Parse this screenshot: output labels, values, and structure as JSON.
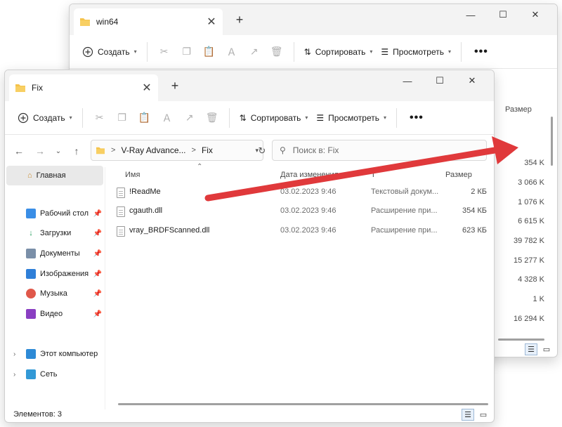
{
  "colors": {
    "folder": "#f5c34b",
    "arrow": "#e0393b",
    "selection": "#e9e9e9",
    "accent": "#2f6fbd"
  },
  "back_window": {
    "tab_title": "win64",
    "toolbar": {
      "create_label": "Создать",
      "sort_label": "Сортировать",
      "view_label": "Просмотреть",
      "more_label": "•••"
    },
    "size_header": "Размер",
    "sizes": [
      "354 K",
      "3 066 K",
      "1 076 K",
      "6 615 K",
      "39 782 K",
      "15 277 K",
      "4 328 K",
      "1 K",
      "16 294 K"
    ]
  },
  "front_window": {
    "tab_title": "Fix",
    "new_tab_label": "+",
    "toolbar": {
      "create_label": "Создать",
      "sort_label": "Сортировать",
      "view_label": "Просмотреть",
      "more_label": "•••"
    },
    "address": {
      "segments": [
        "V-Ray Advance...",
        "Fix"
      ],
      "separator": ">"
    },
    "search_placeholder": "Поиск в: Fix",
    "sidebar": {
      "home": "Главная",
      "quick": [
        {
          "label": "Рабочий стол",
          "icon": "desktop-icon"
        },
        {
          "label": "Загрузки",
          "icon": "download-icon"
        },
        {
          "label": "Документы",
          "icon": "documents-icon"
        },
        {
          "label": "Изображения",
          "icon": "pictures-icon"
        },
        {
          "label": "Музыка",
          "icon": "music-icon"
        },
        {
          "label": "Видео",
          "icon": "video-icon"
        }
      ],
      "this_pc": "Этот компьютер",
      "network": "Сеть"
    },
    "columns": {
      "name": "Имя",
      "date": "Дата изменения",
      "type": "Т",
      "size": "Размер"
    },
    "files": [
      {
        "name": "!ReadMe",
        "date": "03.02.2023 9:46",
        "type": "Текстовый докум...",
        "size": "2 КБ"
      },
      {
        "name": "cgauth.dll",
        "date": "03.02.2023 9:46",
        "type": "Расширение при...",
        "size": "354 КБ"
      },
      {
        "name": "vray_BRDFScanned.dll",
        "date": "03.02.2023 9:46",
        "type": "Расширение при...",
        "size": "623 КБ"
      }
    ],
    "status": "Элементов: 3"
  }
}
